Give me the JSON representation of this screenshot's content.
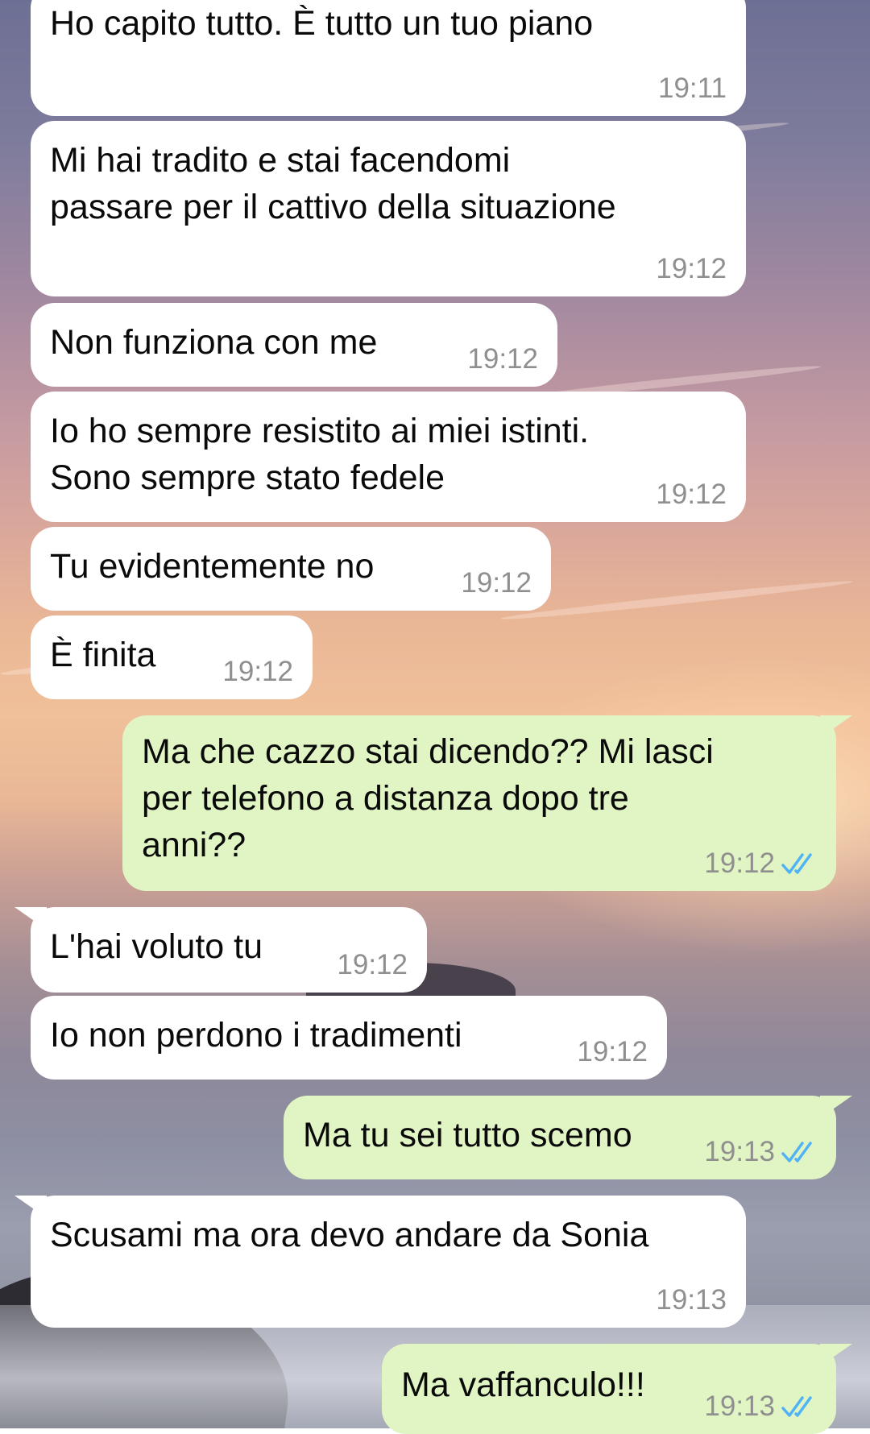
{
  "conversation": {
    "messages": [
      {
        "id": "m1",
        "direction": "incoming",
        "text": "Ho capito tutto. È tutto un tuo piano",
        "time": "19:11"
      },
      {
        "id": "m2",
        "direction": "incoming",
        "text": "Mi hai tradito e stai facendomi\npassare per il cattivo della situazione",
        "time": "19:12"
      },
      {
        "id": "m3",
        "direction": "incoming",
        "text": "Non funziona con me",
        "time": "19:12"
      },
      {
        "id": "m4",
        "direction": "incoming",
        "text": "Io ho sempre resistito ai miei istinti.\nSono sempre stato fedele",
        "time": "19:12"
      },
      {
        "id": "m5",
        "direction": "incoming",
        "text": "Tu evidentemente no",
        "time": "19:12"
      },
      {
        "id": "m6",
        "direction": "incoming",
        "text": "È finita",
        "time": "19:12"
      },
      {
        "id": "m7",
        "direction": "outgoing",
        "text": "Ma che cazzo stai dicendo?? Mi lasci\nper telefono a distanza dopo tre\nanni??",
        "time": "19:12",
        "status": "read"
      },
      {
        "id": "m8",
        "direction": "incoming",
        "text": "L'hai voluto tu",
        "time": "19:12"
      },
      {
        "id": "m9",
        "direction": "incoming",
        "text": "Io non perdono i tradimenti",
        "time": "19:12"
      },
      {
        "id": "m10",
        "direction": "outgoing",
        "text": "Ma tu sei tutto scemo",
        "time": "19:13",
        "status": "read"
      },
      {
        "id": "m11",
        "direction": "incoming",
        "text": "Scusami ma ora devo andare da Sonia",
        "time": "19:13"
      },
      {
        "id": "m12",
        "direction": "outgoing",
        "text": "Ma vaffanculo!!!",
        "time": "19:13",
        "status": "read"
      }
    ]
  },
  "colors": {
    "incoming_bubble": "#ffffff",
    "outgoing_bubble": "#e1f5c4",
    "read_receipt": "#4fb3f6",
    "timestamp": "#8f8f8f"
  },
  "icons": {
    "read_receipt": "double-check-icon"
  }
}
